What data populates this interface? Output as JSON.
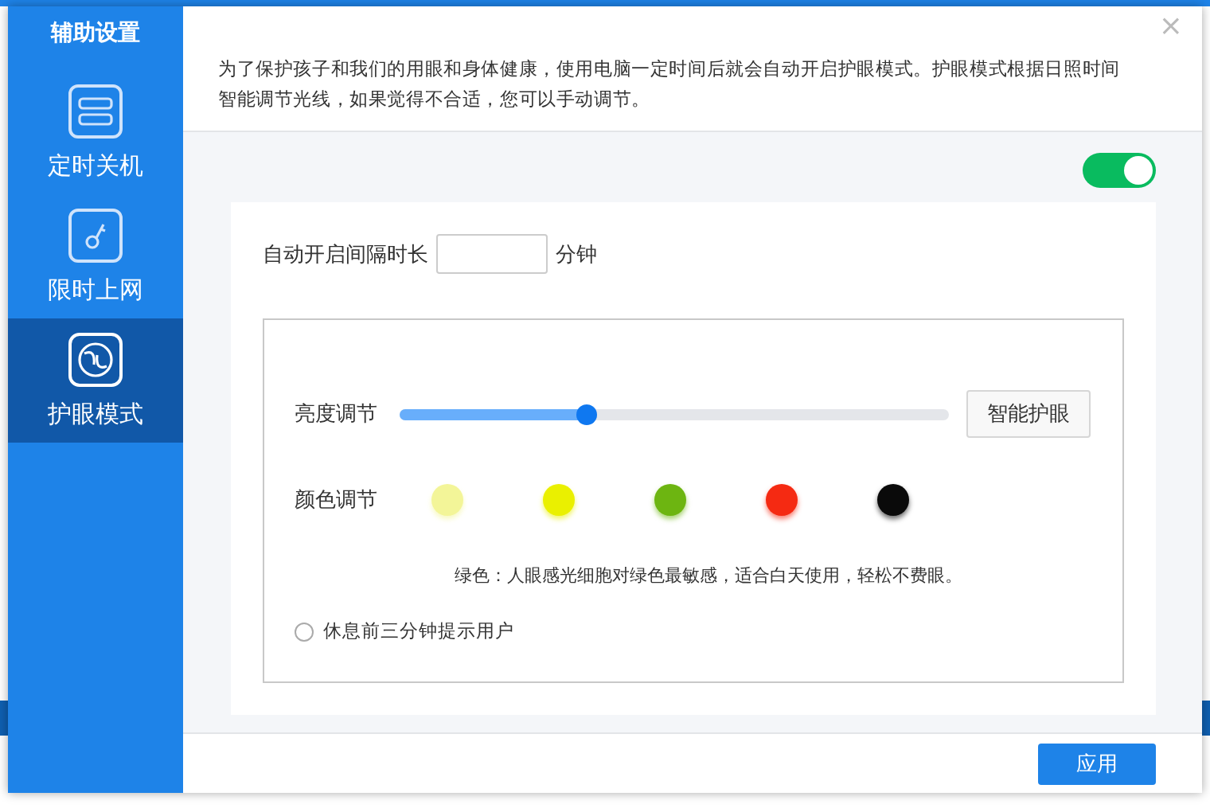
{
  "sidebar": {
    "title": "辅助设置",
    "items": [
      {
        "label": "定时关机",
        "selected": false
      },
      {
        "label": "限时上网",
        "selected": false
      },
      {
        "label": "护眼模式",
        "selected": true
      }
    ]
  },
  "description": "为了保护孩子和我们的用眼和身体健康，使用电脑一定时间后就会自动开启护眼模式。护眼模式根据日照时间智能调节光线，如果觉得不合适，您可以手动调节。",
  "close": "×",
  "enabled": true,
  "interval": {
    "label": "自动开启间隔时长",
    "unit": "分钟"
  },
  "brightness": {
    "label": "亮度调节",
    "level": 0.34,
    "button": "智能护眼"
  },
  "color_adjust": {
    "label": "颜色调节",
    "swatches": [
      {
        "color": "#f3f598"
      },
      {
        "color": "#eaf000"
      },
      {
        "color": "#6db511"
      },
      {
        "color": "#f52a12"
      },
      {
        "color": "#0a0a0a"
      }
    ]
  },
  "color_note": "绿色：人眼感光细胞对绿色最敏感，适合白天使用，轻松不费眼。",
  "remind": {
    "label": "休息前三分钟提示用户",
    "checked": false
  },
  "apply_button": "应用"
}
